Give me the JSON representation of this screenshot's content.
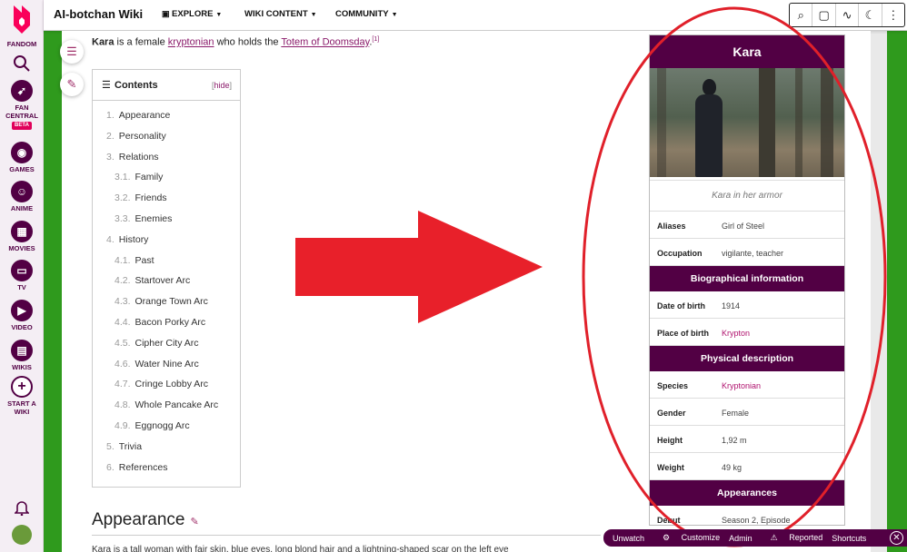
{
  "topbar": {
    "wiki_name": "AI-botchan Wiki",
    "nav": [
      "EXPLORE",
      "WIKI CONTENT",
      "COMMUNITY"
    ],
    "tools": [
      "search-icon",
      "discussions-icon",
      "activity-icon",
      "dark-mode-icon",
      "more-icon"
    ]
  },
  "rail": {
    "brand": "FANDOM",
    "items": [
      {
        "label": "FAN CENTRAL",
        "badge": "BETA",
        "icon": "rocket-icon"
      },
      {
        "label": "GAMES",
        "icon": "controller-icon"
      },
      {
        "label": "ANIME",
        "icon": "anime-icon"
      },
      {
        "label": "MOVIES",
        "icon": "clapper-icon"
      },
      {
        "label": "TV",
        "icon": "tv-icon"
      },
      {
        "label": "VIDEO",
        "icon": "video-icon"
      },
      {
        "label": "WIKIS",
        "icon": "book-icon"
      },
      {
        "label": "START A WIKI",
        "icon": "plus-icon"
      }
    ]
  },
  "intro": {
    "subject": "Kara",
    "text1": " is a female ",
    "link1": "kryptonian",
    "text2": " who holds the ",
    "link2": "Totem of Doomsday",
    "text3": ".",
    "ref": "[1]"
  },
  "toc": {
    "title": "Contents",
    "hide": "hide",
    "items": [
      {
        "num": "1.",
        "label": "Appearance",
        "level": 1
      },
      {
        "num": "2.",
        "label": "Personality",
        "level": 1
      },
      {
        "num": "3.",
        "label": "Relations",
        "level": 1
      },
      {
        "num": "3.1.",
        "label": "Family",
        "level": 2
      },
      {
        "num": "3.2.",
        "label": "Friends",
        "level": 2
      },
      {
        "num": "3.3.",
        "label": "Enemies",
        "level": 2
      },
      {
        "num": "4.",
        "label": "History",
        "level": 1
      },
      {
        "num": "4.1.",
        "label": "Past",
        "level": 2
      },
      {
        "num": "4.2.",
        "label": "Startover Arc",
        "level": 2
      },
      {
        "num": "4.3.",
        "label": "Orange Town Arc",
        "level": 2
      },
      {
        "num": "4.4.",
        "label": "Bacon Porky Arc",
        "level": 2
      },
      {
        "num": "4.5.",
        "label": "Cipher City Arc",
        "level": 2
      },
      {
        "num": "4.6.",
        "label": "Water Nine Arc",
        "level": 2
      },
      {
        "num": "4.7.",
        "label": "Cringe Lobby Arc",
        "level": 2
      },
      {
        "num": "4.8.",
        "label": "Whole Pancake Arc",
        "level": 2
      },
      {
        "num": "4.9.",
        "label": "Eggnogg Arc",
        "level": 2
      },
      {
        "num": "5.",
        "label": "Trivia",
        "level": 1
      },
      {
        "num": "6.",
        "label": "References",
        "level": 1
      }
    ]
  },
  "section": {
    "heading": "Appearance",
    "body": "Kara is a tall woman with fair skin, blue eyes, long blond hair and a lightning-shaped scar on the left eye"
  },
  "infobox": {
    "title": "Kara",
    "caption": "Kara in her armor",
    "rows_a": [
      {
        "label": "Aliases",
        "value": "Girl of Steel"
      },
      {
        "label": "Occupation",
        "value": "vigilante, teacher"
      }
    ],
    "group_bio": "Biographical information",
    "rows_b": [
      {
        "label": "Date of birth",
        "value": "1914"
      },
      {
        "label": "Place of birth",
        "value": "Krypton"
      }
    ],
    "group_phys": "Physical description",
    "rows_c": [
      {
        "label": "Species",
        "value": "Kryptonian"
      },
      {
        "label": "Gender",
        "value": "Female"
      },
      {
        "label": "Height",
        "value": "1,92 m"
      },
      {
        "label": "Weight",
        "value": "49 kg"
      }
    ],
    "group_app": "Appearances",
    "rows_d": [
      {
        "label": "Debut",
        "value": "Season 2, Episode"
      }
    ]
  },
  "bottombar": {
    "items": [
      "Unwatch",
      "Customize",
      "Admin",
      "Reported",
      "Shortcuts"
    ]
  },
  "colors": {
    "brand": "#520044",
    "link": "#8a1a6a",
    "annotation": "#e0202a",
    "band": "#2f9a1d"
  }
}
